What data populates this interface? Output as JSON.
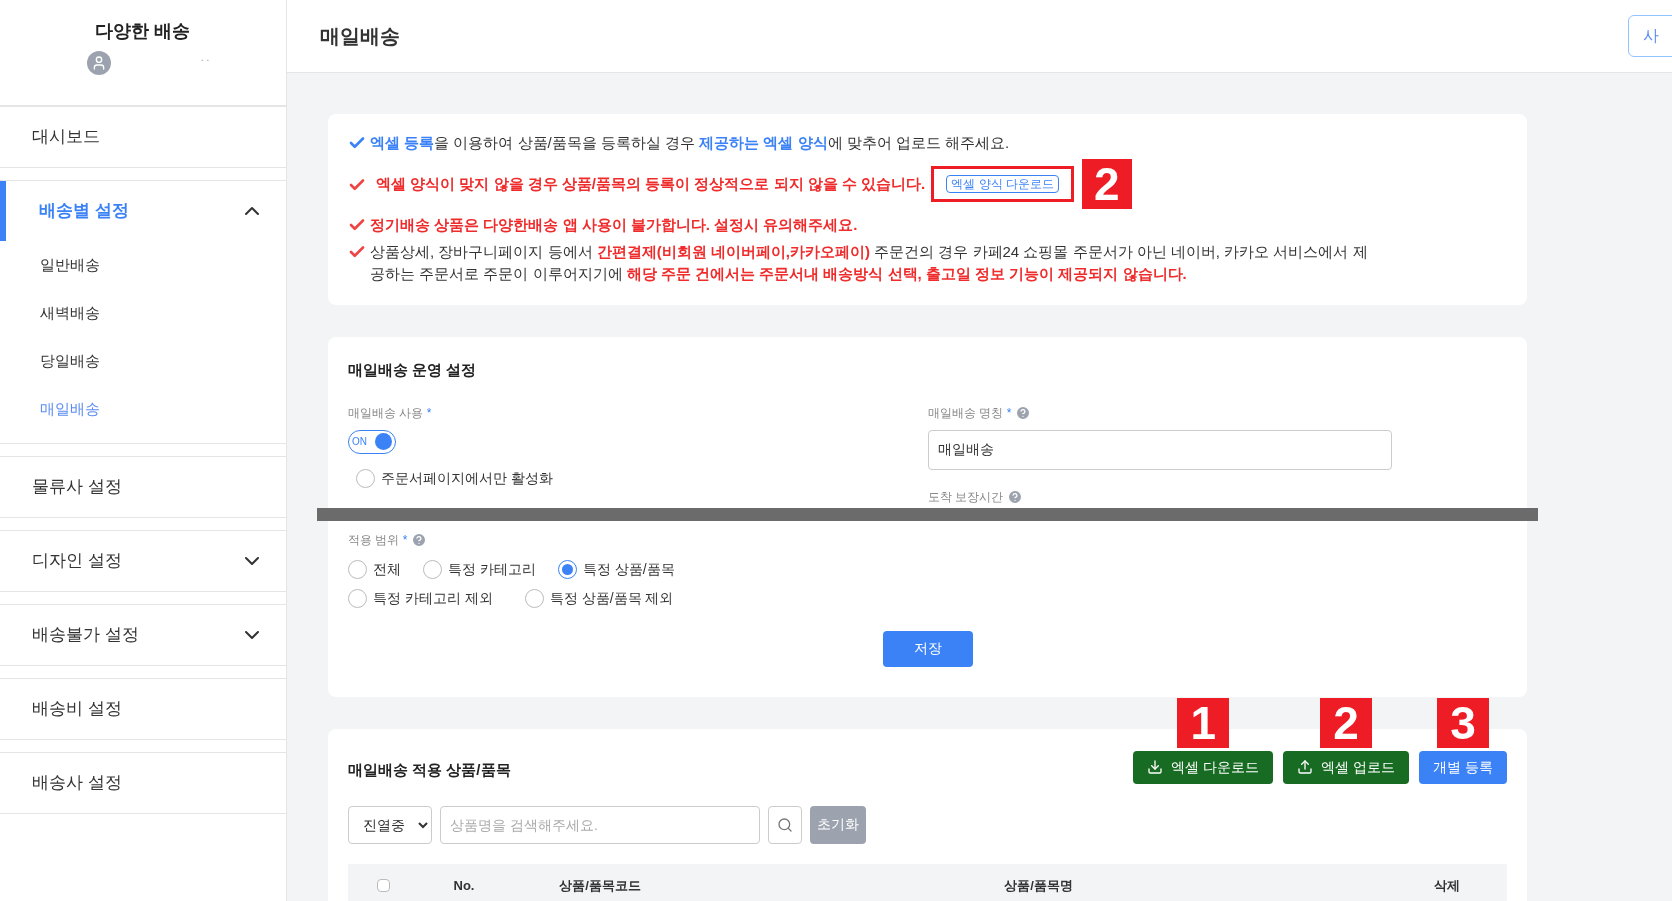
{
  "sidebar": {
    "title": "다양한 배송",
    "user_name": ". .",
    "items": [
      {
        "label": "대시보드",
        "kind": "link"
      },
      {
        "label": "배송별 설정",
        "kind": "group",
        "expanded": true,
        "selected": true,
        "children": [
          {
            "label": "일반배송",
            "selected": false
          },
          {
            "label": "새벽배송",
            "selected": false
          },
          {
            "label": "당일배송",
            "selected": false
          },
          {
            "label": "매일배송",
            "selected": true
          }
        ]
      },
      {
        "label": "물류사 설정",
        "kind": "link"
      },
      {
        "label": "디자인 설정",
        "kind": "group",
        "expanded": false,
        "selected": false
      },
      {
        "label": "배송불가 설정",
        "kind": "group",
        "expanded": false,
        "selected": false
      },
      {
        "label": "배송비 설정",
        "kind": "link"
      },
      {
        "label": "배송사 설정",
        "kind": "link"
      }
    ]
  },
  "header": {
    "title": "매일배송",
    "button": "사"
  },
  "notices": [
    {
      "color": "#3b82f6",
      "segments": [
        {
          "text": "엑셀 등록",
          "kind": "blue"
        },
        {
          "text": "을 이용하여 상품/품목을 등록하실 경우 ",
          "kind": "plain"
        },
        {
          "text": "제공하는 엑셀 양식",
          "kind": "blue"
        },
        {
          "text": "에 맞추어 업로드 해주세요.",
          "kind": "plain"
        }
      ]
    },
    {
      "color": "#ef4444",
      "segments": [
        {
          "text": "엑셀 양식이 맞지 않을 경우 상품/품목의 등록이 정상적으로 되지 않을 수 있습니다.",
          "kind": "red"
        }
      ],
      "link": "엑셀 양식 다운로드",
      "annotation": "2"
    },
    {
      "color": "#ef4444",
      "segments": [
        {
          "text": "정기배송 상품은 다양한배송 앱 사용이 불가합니다. 설정시 유의해주세요.",
          "kind": "red"
        }
      ]
    },
    {
      "color": "#ef4444",
      "segments": [
        {
          "text": "상품상세, 장바구니페이지 등에서 ",
          "kind": "plain"
        },
        {
          "text": "간편결제(비회원 네이버페이,카카오페이)",
          "kind": "red"
        },
        {
          "text": " 주문건의 경우 카페24 쇼핑몰 주문서가 아닌 네이버, 카카오 서비스에서 제공하는 주문서로 주문이 이루어지기에 ",
          "kind": "plain"
        },
        {
          "text": "해당 주문 건에서는 주문서내 배송방식 선택, 출고일 정보 기능이 제공되지 않습니다.",
          "kind": "red"
        }
      ]
    }
  ],
  "settings": {
    "title": "매일배송 운영 설정",
    "use": {
      "label": "매일배송 사용",
      "required": "*",
      "toggle": "ON",
      "on": true
    },
    "order_page_only": {
      "label": "주문서페이지에서만 활성화",
      "checked": false
    },
    "name": {
      "label": "매일배송 명칭",
      "required": "*",
      "value": "매일배송"
    },
    "arrival": {
      "label": "도착 보장시간"
    },
    "scope": {
      "label": "적용 범위",
      "required": "*",
      "options": [
        {
          "label": "전체",
          "selected": false
        },
        {
          "label": "특정 카테고리",
          "selected": false
        },
        {
          "label": "특정 상품/품목",
          "selected": true
        },
        {
          "label": "특정 카테고리 제외",
          "selected": false
        },
        {
          "label": "특정 상품/품목 제외",
          "selected": false
        }
      ]
    },
    "save": "저장"
  },
  "products": {
    "title": "매일배송 적용 상품/품목",
    "buttons": [
      {
        "label": "엑셀 다운로드",
        "kind": "download",
        "annotation": "1"
      },
      {
        "label": "엑셀 업로드",
        "kind": "upload",
        "annotation": "2"
      },
      {
        "label": "개별 등록",
        "kind": "plain",
        "annotation": "3"
      }
    ],
    "filter": "진열중",
    "search_placeholder": "상품명을 검색해주세요.",
    "reset": "초기화",
    "columns": [
      {
        "label": "No."
      },
      {
        "label": "상품/품목코드"
      },
      {
        "label": "상품/품목명"
      },
      {
        "label": "삭제"
      }
    ],
    "select_all_checked": false
  }
}
